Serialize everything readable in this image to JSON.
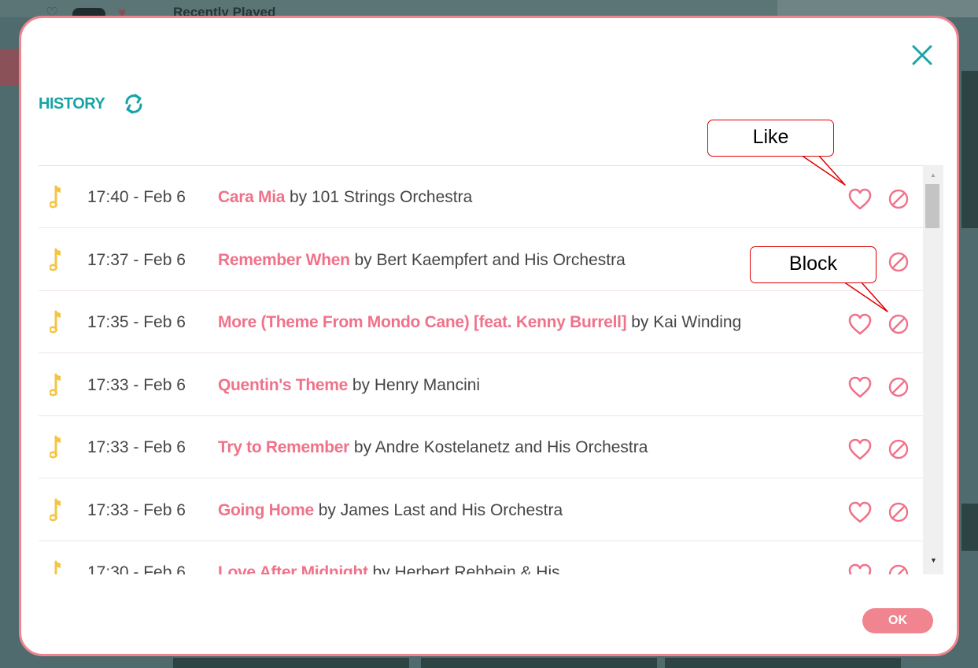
{
  "background": {
    "title": "Recently Played"
  },
  "modal": {
    "header_title": "HISTORY",
    "ok_label": "OK",
    "rows": [
      {
        "time": "17:40 - Feb 6",
        "title": "Cara Mia",
        "by": "by 101 Strings Orchestra"
      },
      {
        "time": "17:37 - Feb 6",
        "title": "Remember When",
        "by": "by Bert Kaempfert and His Orchestra"
      },
      {
        "time": "17:35 - Feb 6",
        "title": "More (Theme From Mondo Cane) [feat. Kenny Burrell]",
        "by": "by Kai Winding"
      },
      {
        "time": "17:33 - Feb 6",
        "title": "Quentin's Theme",
        "by": "by Henry Mancini"
      },
      {
        "time": "17:33 - Feb 6",
        "title": "Try to Remember",
        "by": "by Andre Kostelanetz and His Orchestra"
      },
      {
        "time": "17:33 - Feb 6",
        "title": "Going Home",
        "by": "by James Last and His Orchestra"
      },
      {
        "time": "17:30 - Feb 6",
        "title": "Love After Midnight",
        "by": "by Herbert Rehbein & His"
      }
    ]
  },
  "callouts": {
    "like": "Like",
    "block": "Block"
  },
  "icons": {
    "close": "close-icon",
    "refresh": "refresh-icon",
    "note": "music-note-icon",
    "like": "heart-icon",
    "block": "block-icon"
  },
  "colors": {
    "accent_teal": "#19a3a5",
    "accent_pink": "#f0728a",
    "note_yellow": "#f5c443",
    "callout_red": "#e00000"
  }
}
